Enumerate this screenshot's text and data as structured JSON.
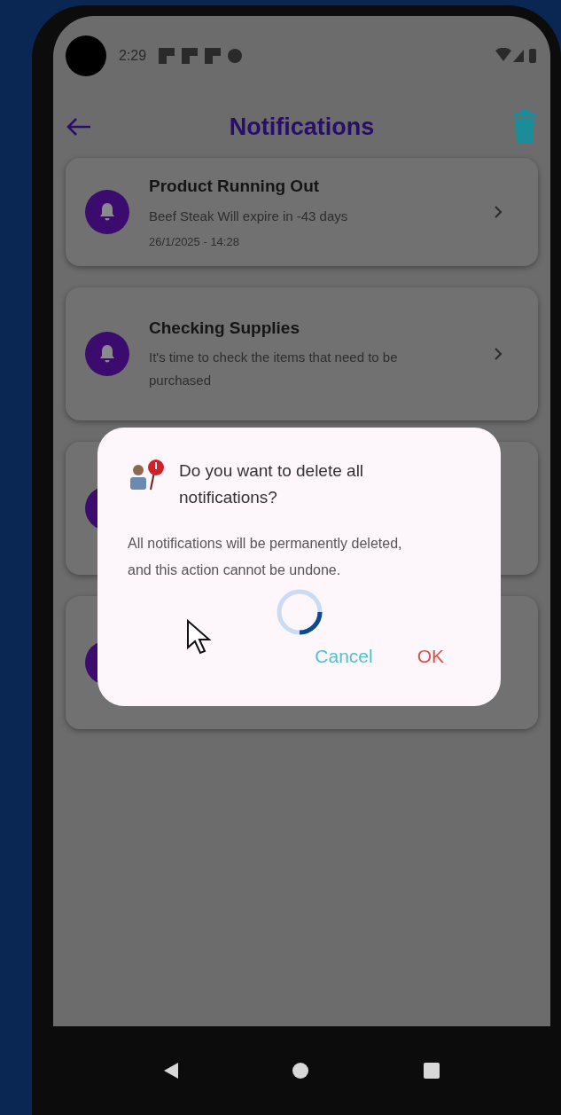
{
  "status_bar": {
    "time": "2:29"
  },
  "app_bar": {
    "title": "Notifications"
  },
  "notifications": [
    {
      "kind": "text",
      "title": "Product Running Out",
      "message": "Beef Steak Will expire in -43 days",
      "time": "26/1/2025 - 14:28"
    },
    {
      "kind": "text",
      "title": "Checking Supplies",
      "message": "It's time to check the items that need to be purchased"
    },
    {
      "kind": "covered"
    },
    {
      "kind": "covered"
    }
  ],
  "dialog": {
    "title": "Do you want to delete all notifications?",
    "message": "All notifications will be permanently deleted, and this action cannot be undone.",
    "buttons": [
      {
        "label": "Cancel",
        "kind": "cancel"
      },
      {
        "label": "OK",
        "kind": "confirm"
      }
    ]
  }
}
